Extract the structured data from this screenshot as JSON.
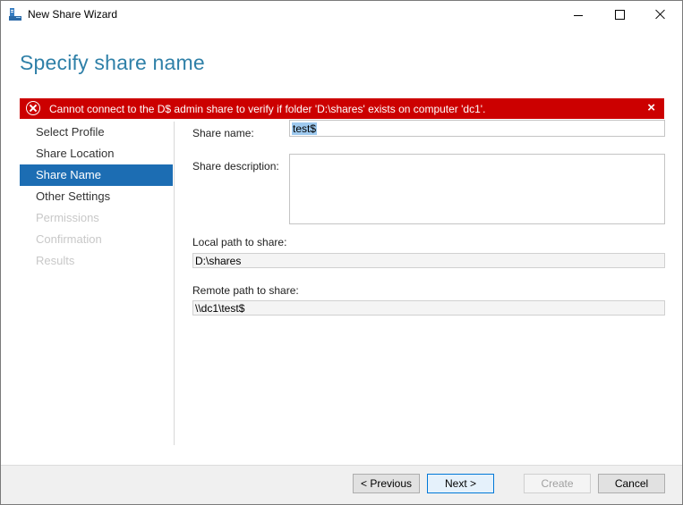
{
  "window": {
    "title": "New Share Wizard"
  },
  "page": {
    "title": "Specify share name"
  },
  "error": {
    "message": "Cannot connect to the D$ admin share to verify if folder 'D:\\shares' exists on computer 'dc1'.",
    "close_glyph": "×",
    "color": "#cc0000"
  },
  "nav": {
    "items": [
      {
        "label": "Select Profile",
        "state": "normal"
      },
      {
        "label": "Share Location",
        "state": "normal"
      },
      {
        "label": "Share Name",
        "state": "active"
      },
      {
        "label": "Other Settings",
        "state": "normal"
      },
      {
        "label": "Permissions",
        "state": "disabled"
      },
      {
        "label": "Confirmation",
        "state": "disabled"
      },
      {
        "label": "Results",
        "state": "disabled"
      }
    ]
  },
  "form": {
    "share_name_label": "Share name:",
    "share_name_value": "test$",
    "share_description_label": "Share description:",
    "share_description_value": "",
    "local_path_label": "Local path to share:",
    "local_path_value": "D:\\shares",
    "remote_path_label": "Remote path to share:",
    "remote_path_value": "\\\\dc1\\test$"
  },
  "buttons": {
    "previous": "< Previous",
    "next": "Next >",
    "create": "Create",
    "cancel": "Cancel"
  },
  "colors": {
    "accent": "#1c6db3",
    "title": "#2f80a8"
  }
}
